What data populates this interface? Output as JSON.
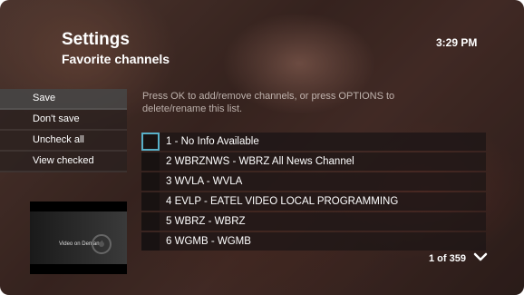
{
  "header": {
    "title": "Settings",
    "subtitle": "Favorite channels",
    "clock": "3:29 PM"
  },
  "menu": {
    "items": [
      {
        "label": "Save"
      },
      {
        "label": "Don't save"
      },
      {
        "label": "Uncheck all"
      },
      {
        "label": "View checked"
      }
    ]
  },
  "hint": "Press OK to add/remove channels, or press OPTIONS to delete/rename this list.",
  "channels": [
    {
      "label": "1 - No Info Available",
      "checked": false
    },
    {
      "label": "2 WBRZNWS - WBRZ All News Channel",
      "checked": false
    },
    {
      "label": "3 WVLA - WVLA",
      "checked": false
    },
    {
      "label": "4 EVLP - EATEL VIDEO LOCAL PROGRAMMING",
      "checked": false
    },
    {
      "label": "5 WBRZ - WBRZ",
      "checked": false
    },
    {
      "label": "6 WGMB - WGMB",
      "checked": false
    }
  ],
  "preview": {
    "label": "Video on Demand"
  },
  "pager": {
    "text": "1 of 359",
    "next_icon": "chevron-down-icon"
  },
  "colors": {
    "focus_border": "#58b0c8"
  }
}
